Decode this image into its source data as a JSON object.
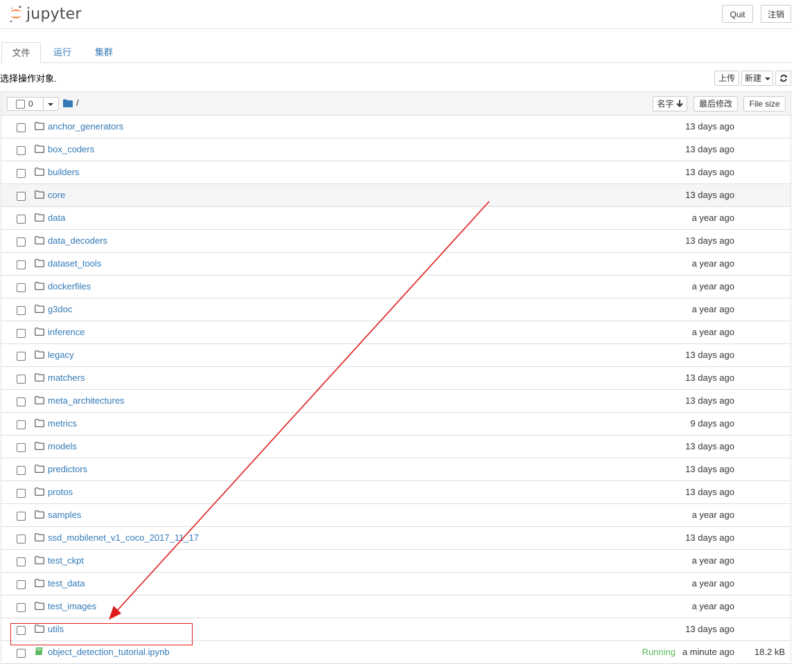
{
  "header": {
    "logo_text": "jupyter",
    "quit_label": "Quit",
    "logout_label": "注销"
  },
  "tabs": [
    {
      "label": "文件",
      "active": true
    },
    {
      "label": "运行",
      "active": false
    },
    {
      "label": "集群",
      "active": false
    }
  ],
  "toolbar": {
    "select_hint": "选择操作对象.",
    "upload_label": "上传",
    "new_label": "新建",
    "refresh_icon": "refresh-icon"
  },
  "list_header": {
    "selected_count": "0",
    "breadcrumb": "/",
    "sort_name_label": "名字",
    "sort_modified_label": "最后修改",
    "sort_size_label": "File size"
  },
  "items": [
    {
      "name": "anchor_generators",
      "type": "folder",
      "modified": "13 days ago"
    },
    {
      "name": "box_coders",
      "type": "folder",
      "modified": "13 days ago"
    },
    {
      "name": "builders",
      "type": "folder",
      "modified": "13 days ago"
    },
    {
      "name": "core",
      "type": "folder",
      "modified": "13 days ago"
    },
    {
      "name": "data",
      "type": "folder",
      "modified": "a year ago"
    },
    {
      "name": "data_decoders",
      "type": "folder",
      "modified": "13 days ago"
    },
    {
      "name": "dataset_tools",
      "type": "folder",
      "modified": "a year ago"
    },
    {
      "name": "dockerfiles",
      "type": "folder",
      "modified": "a year ago"
    },
    {
      "name": "g3doc",
      "type": "folder",
      "modified": "a year ago"
    },
    {
      "name": "inference",
      "type": "folder",
      "modified": "a year ago"
    },
    {
      "name": "legacy",
      "type": "folder",
      "modified": "13 days ago"
    },
    {
      "name": "matchers",
      "type": "folder",
      "modified": "13 days ago"
    },
    {
      "name": "meta_architectures",
      "type": "folder",
      "modified": "13 days ago"
    },
    {
      "name": "metrics",
      "type": "folder",
      "modified": "9 days ago"
    },
    {
      "name": "models",
      "type": "folder",
      "modified": "13 days ago"
    },
    {
      "name": "predictors",
      "type": "folder",
      "modified": "13 days ago"
    },
    {
      "name": "protos",
      "type": "folder",
      "modified": "13 days ago"
    },
    {
      "name": "samples",
      "type": "folder",
      "modified": "a year ago"
    },
    {
      "name": "ssd_mobilenet_v1_coco_2017_11_17",
      "type": "folder",
      "modified": "13 days ago"
    },
    {
      "name": "test_ckpt",
      "type": "folder",
      "modified": "a year ago"
    },
    {
      "name": "test_data",
      "type": "folder",
      "modified": "a year ago"
    },
    {
      "name": "test_images",
      "type": "folder",
      "modified": "a year ago"
    },
    {
      "name": "utils",
      "type": "folder",
      "modified": "13 days ago"
    },
    {
      "name": "object_detection_tutorial.ipynb",
      "type": "notebook",
      "modified": "a minute ago",
      "status": "Running",
      "size": "18.2 kB"
    }
  ],
  "colors": {
    "link": "#337ab7",
    "running": "#5cb85c",
    "annotation": "#e01b1b",
    "logo_orange": "#f37726"
  }
}
